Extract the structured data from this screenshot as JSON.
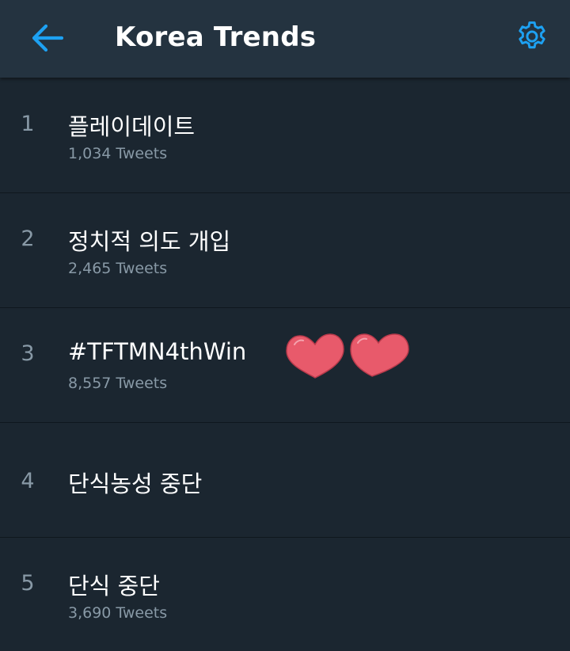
{
  "header": {
    "title": "Korea Trends",
    "back_icon": "arrow-left-icon",
    "settings_icon": "gear-icon",
    "accent_color": "#1da1f2"
  },
  "trends": [
    {
      "rank": "1",
      "name": "플레이데이트",
      "tweets": "1,034 Tweets"
    },
    {
      "rank": "2",
      "name": "정치적 의도 개입",
      "tweets": "2,465 Tweets"
    },
    {
      "rank": "3",
      "name": "#TFTMN4thWin",
      "tweets": "8,557 Tweets"
    },
    {
      "rank": "4",
      "name": "단식농성 중단",
      "tweets": ""
    },
    {
      "rank": "5",
      "name": "단식 중단",
      "tweets": "3,690 Tweets"
    }
  ],
  "decoration": {
    "icon": "hearts-sticker-icon",
    "color": "#e85a6b"
  }
}
